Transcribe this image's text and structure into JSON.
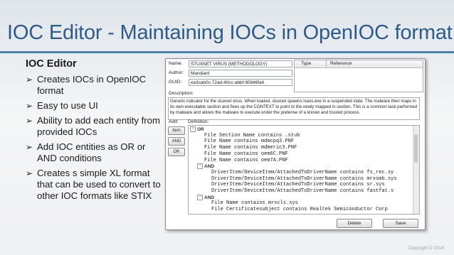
{
  "slide": {
    "title": "IOC Editor - Maintaining IOCs in OpenIOC format",
    "heading": "IOC Editor",
    "bullets": [
      "Creates IOCs in OpenIOC format",
      "Easy to use UI",
      "Ability to add each entity from provided IOCs",
      "Add IOC entities as OR or AND conditions",
      "Creates s simple XL format that can be used to convert to other IOC formats like STIX"
    ],
    "copyright": "Copyright © 2014",
    "accent": "#2e5b8a"
  },
  "editor": {
    "name_label": "Name:",
    "name_value": "STUXNET VIRUS (METHODOLOGY)",
    "author_label": "Author:",
    "author_value": "Mandiant",
    "guid_label": "GUID:",
    "guid_value": "ea3cab0c-72ad-40cc-abbf-90846fa4",
    "type_header": "Type",
    "reference_header": "Reference",
    "description_label": "Description:",
    "description": "Generic indicator for the stuxnet virus.  When loaded, stuxnet spawns lsass.exe in a suspended state. The malware then maps in its own executable section and fixes up the CONTEXT to point to the newly mapped in section. This is a common task performed by malware and allows the malware to execute under the pretense of a known and trusted process.",
    "add_label": "Add:",
    "definition_label": "Definition:",
    "buttons": {
      "item": "Item",
      "and": "AND",
      "or": "OR"
    },
    "tree": [
      {
        "type": "op",
        "text": "OR",
        "expander": "⊟"
      },
      {
        "type": "cond",
        "text": "File Section Name contains .stub"
      },
      {
        "type": "cond",
        "text": "File Name contains mdmcpq3.PNF"
      },
      {
        "type": "cond",
        "text": "File Name contains mdmeric3.PNF"
      },
      {
        "type": "cond",
        "text": "File Name contains oem6C.PNF"
      },
      {
        "type": "cond",
        "text": "File Name contains oem7A.PNF"
      },
      {
        "type": "op",
        "text": "AND",
        "expander": "⊟"
      },
      {
        "type": "cond",
        "text": "DriverItem/DeviceItem/AttachedToDriverName contains fs_rec.sy"
      },
      {
        "type": "cond",
        "text": "DriverItem/DeviceItem/AttachedToDriverName contains mrxsmb.sys"
      },
      {
        "type": "cond",
        "text": "DriverItem/DeviceItem/AttachedToDriverName contains sr.sys"
      },
      {
        "type": "cond",
        "text": "DriverItem/DeviceItem/AttachedToDriverName contains fastfat.s"
      },
      {
        "type": "op",
        "text": "AND",
        "expander": "⊟"
      },
      {
        "type": "cond",
        "text": "File Name contains mrxcls.sys"
      },
      {
        "type": "cond",
        "text": "File Certificatesubject contains Realtek Semiconductor Corp"
      }
    ],
    "delete_label": "Delete",
    "save_label": "Save"
  }
}
